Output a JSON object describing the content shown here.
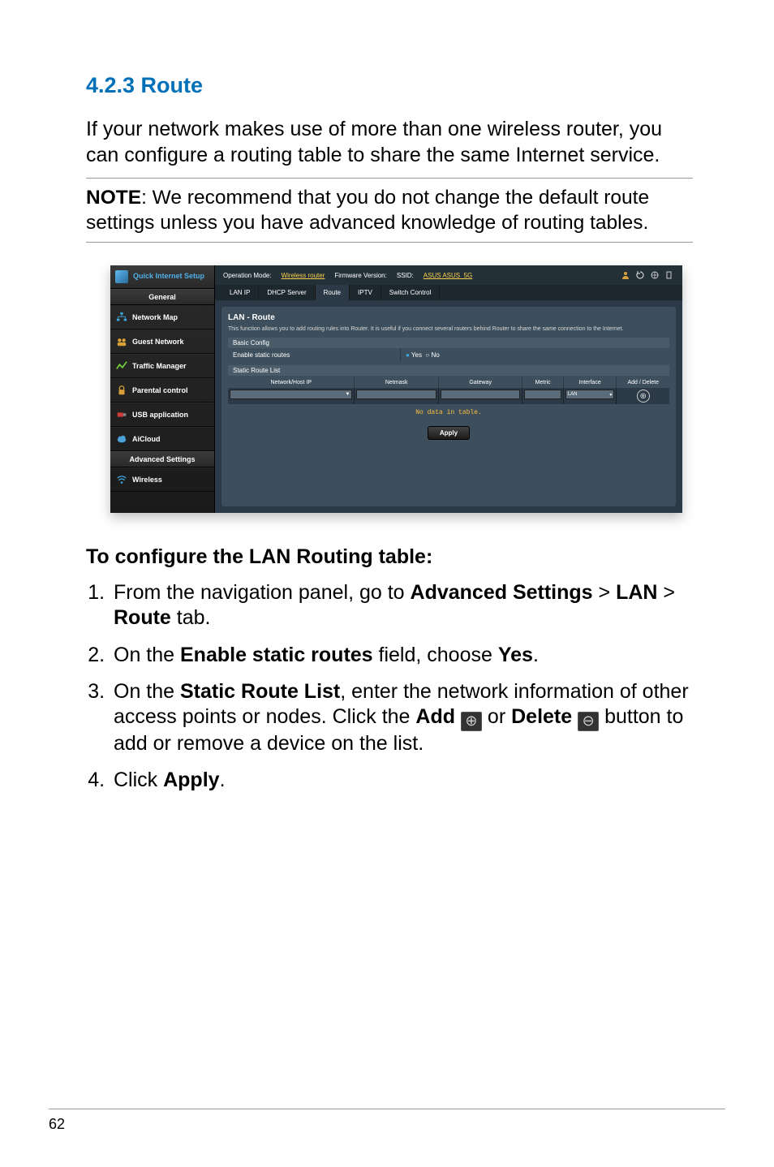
{
  "heading": "4.2.3 Route",
  "intro": "If your network makes use of more than one wireless router, you can configure a routing table to share the same Internet service.",
  "note_label": "NOTE",
  "note_text": ":  We recommend that you do not change the default route settings unless you have advanced knowledge of routing tables.",
  "subheading": "To configure the LAN Routing table:",
  "steps": {
    "s1a": "From the navigation panel, go to ",
    "s1b": "Advanced Settings",
    "s1c": " > ",
    "s1d": "LAN",
    "s1e": " > ",
    "s1f": "Route",
    "s1g": " tab.",
    "s2a": "On the ",
    "s2b": "Enable static routes",
    "s2c": " field, choose ",
    "s2d": "Yes",
    "s2e": ".",
    "s3a": "On the ",
    "s3b": "Static Route List",
    "s3c": ", enter the network information of other access points or nodes. Click the ",
    "s3d": "Add",
    "s3e": " or ",
    "s3f": "Delete",
    "s3g": " button to add or remove a device on the list.",
    "s4a": "Click ",
    "s4b": "Apply",
    "s4c": "."
  },
  "page_number": "62",
  "router": {
    "qis": "Quick Internet Setup",
    "general": "General",
    "sidebar": {
      "network_map": "Network Map",
      "guest_network": "Guest Network",
      "traffic_manager": "Traffic Manager",
      "parental_control": "Parental control",
      "usb_application": "USB application",
      "aicloud": "AiCloud"
    },
    "adv": "Advanced Settings",
    "wireless": "Wireless",
    "top": {
      "opmode_label": "Operation Mode: ",
      "opmode_value": "Wireless router",
      "fw_label": "Firmware Version:",
      "ssid_label": "SSID: ",
      "ssid_value": "ASUS  ASUS_5G"
    },
    "tabs": {
      "lan_ip": "LAN IP",
      "dhcp": "DHCP Server",
      "route": "Route",
      "iptv": "IPTV",
      "switch": "Switch Control"
    },
    "panel": {
      "title": "LAN - Route",
      "desc": "This function allows you to add routing rules into Router. It is useful if you connect several routers behind Router to share the same connection to the Internet.",
      "basic_config": "Basic Config",
      "enable_static": "Enable static routes",
      "yes": "Yes",
      "no": "No",
      "static_list": "Static Route List",
      "cols": {
        "np": "Network/Host IP",
        "nm": "Netmask",
        "gw": "Gateway",
        "metric": "Metric",
        "iface": "Interface",
        "ad": "Add / Delete"
      },
      "iface_value": "LAN",
      "no_data": "No data in table.",
      "apply": "Apply"
    }
  }
}
